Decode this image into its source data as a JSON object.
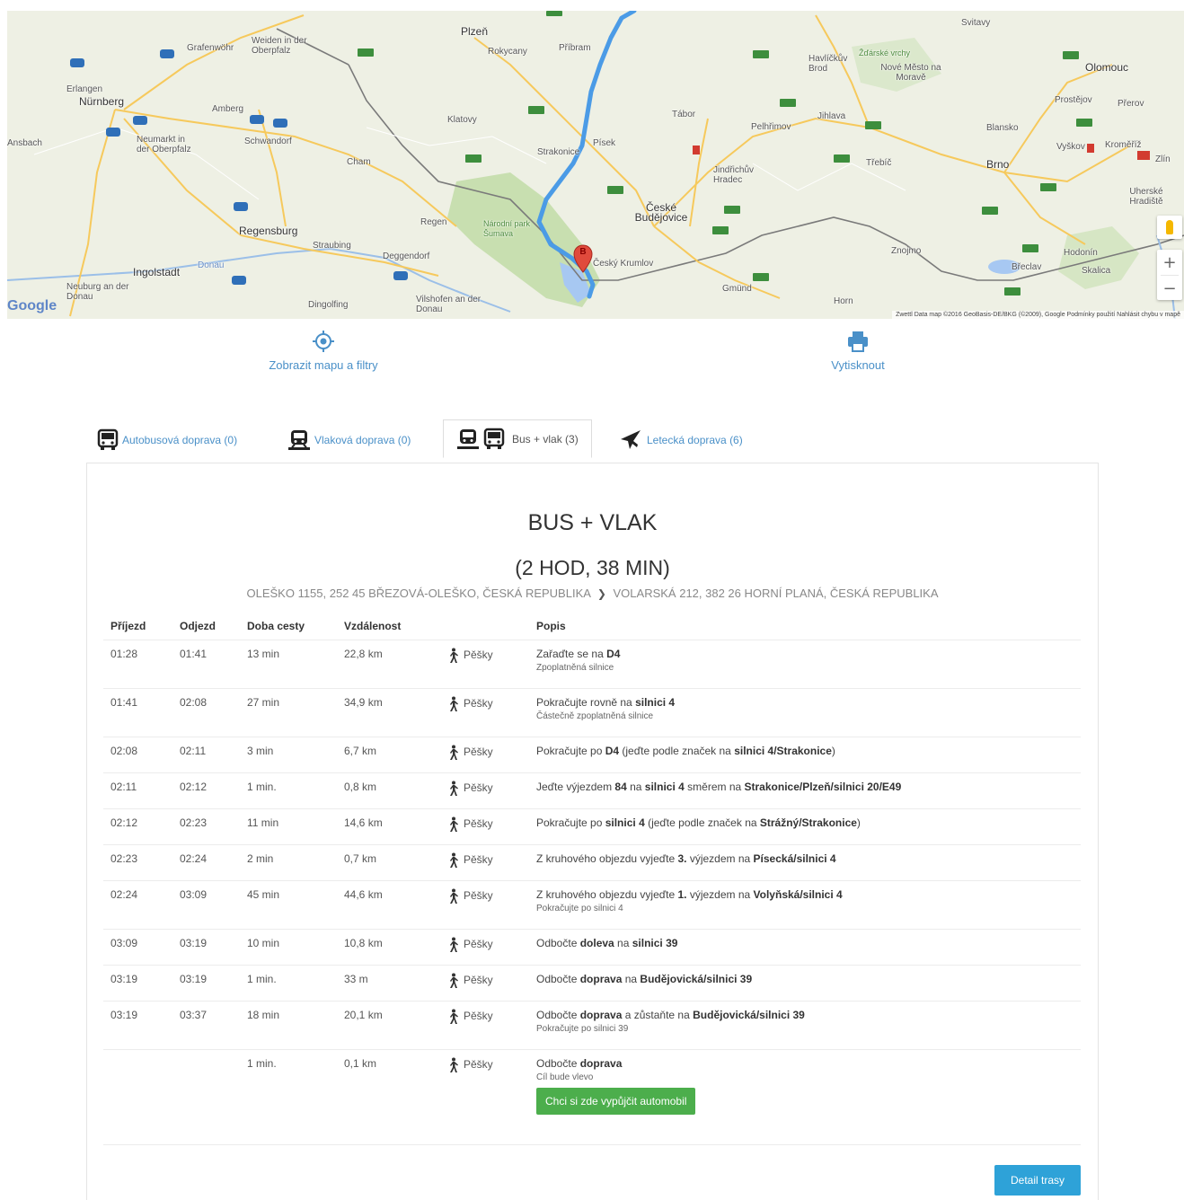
{
  "map": {
    "labels": {
      "nurnberg": "Nürnberg",
      "erlangen": "Erlangen",
      "ansbach": "Ansbach",
      "amberg": "Amberg",
      "schwandorf": "Schwandorf",
      "neumarkt": "Neumarkt in der Oberpfalz",
      "weiden": "Weiden in der Oberpfalz",
      "grafenwohr": "Grafenwöhr",
      "regensburg": "Regensburg",
      "ingolstadt": "Ingolstadt",
      "neuburg": "Neuburg an der Donau",
      "straubing": "Straubing",
      "deggendorf": "Deggendorf",
      "dingolfing": "Dingolfing",
      "vilshofen": "Vilshofen an der Donau",
      "cham": "Cham",
      "regen": "Regen",
      "plzen": "Plzeň",
      "rokycany": "Rokycany",
      "pribram": "Příbram",
      "klatovy": "Klatovy",
      "strakonice": "Strakonice",
      "pisek": "Písek",
      "tabor": "Tábor",
      "ceske_budejovice": "České Budějovice",
      "cesky_krumlov": "Český Krumlov",
      "sumava": "Národní park Šumava",
      "pelhrimov": "Pelhřimov",
      "jihlava": "Jihlava",
      "havlickuv_brod": "Havlíčkův Brod",
      "zdarske_vrchy": "Žďárské vrchy",
      "nove_mesto": "Nové Město na Moravě",
      "jindrichuv_hradec": "Jindřichův Hradec",
      "trebic": "Třebíč",
      "znojmo": "Znojmo",
      "brno": "Brno",
      "blansko": "Blansko",
      "olomouc": "Olomouc",
      "prostejov": "Prostějov",
      "prerov": "Přerov",
      "vyskov": "Vyškov",
      "kromeriz": "Kroměříž",
      "zlin": "Zlín",
      "uherske_hradiste": "Uherské Hradiště",
      "hodonin": "Hodonín",
      "skalica": "Skalica",
      "breclav": "Břeclav",
      "zwettl": "Zwettl",
      "gmund": "Gmünd",
      "horn": "Horn",
      "svitavy": "Svitavy",
      "donau": "Donau"
    },
    "google": "Google",
    "attribution": "Zwettl   Data map ©2016 GeoBasis-DE/BKG (©2009), Google   Podmínky použití   Nahlásit chybu v mapě",
    "marker_label": "B"
  },
  "actions": {
    "show_map": "Zobrazit mapu a filtry",
    "print": "Vytisknout"
  },
  "tabs": [
    {
      "label": "Autobusová doprava (0)"
    },
    {
      "label": "Vlaková doprava (0)"
    },
    {
      "label": "Bus + vlak (3)"
    },
    {
      "label": "Letecká doprava (6)"
    }
  ],
  "panel": {
    "title": "BUS + VLAK",
    "duration": "(2 HOD, 38 MIN)",
    "from": "OLEŠKO 1155, 252 45 BŘEZOVÁ-OLEŠKO, ČESKÁ REPUBLIKA",
    "to": "VOLARSKÁ 212, 382 26 HORNÍ PLANÁ, ČESKÁ REPUBLIKA",
    "headers": [
      "Příjezd",
      "Odjezd",
      "Doba cesty",
      "Vzdálenost",
      "",
      "Popis"
    ],
    "walk_label": "Pěšky",
    "rent_button": "Chci si zde vypůjčit automobil",
    "detail_button": "Detail trasy"
  },
  "steps": [
    {
      "arr": "01:28",
      "dep": "01:41",
      "dur": "13 min",
      "dist": "22,8 km",
      "desc_parts": [
        "Zařaďte se na ",
        "D4"
      ],
      "sub": "Zpoplatněná silnice"
    },
    {
      "arr": "01:41",
      "dep": "02:08",
      "dur": "27 min",
      "dist": "34,9 km",
      "desc_parts": [
        "Pokračujte rovně na ",
        "silnici 4"
      ],
      "sub": "Částečně zpoplatněná silnice"
    },
    {
      "arr": "02:08",
      "dep": "02:11",
      "dur": "3 min",
      "dist": "6,7 km",
      "desc_parts": [
        "Pokračujte po ",
        "D4",
        " (jeďte podle značek na ",
        "silnici 4/Strakonice",
        ")"
      ],
      "sub": ""
    },
    {
      "arr": "02:11",
      "dep": "02:12",
      "dur": "1 min.",
      "dist": "0,8 km",
      "desc_parts": [
        "Jeďte výjezdem ",
        "84",
        " na ",
        "silnici 4",
        " směrem na ",
        "Strakonice/Plzeň/silnici 20/E49"
      ],
      "sub": ""
    },
    {
      "arr": "02:12",
      "dep": "02:23",
      "dur": "11 min",
      "dist": "14,6 km",
      "desc_parts": [
        "Pokračujte po ",
        "silnici 4",
        " (jeďte podle značek na ",
        "Strážný/Strakonice",
        ")"
      ],
      "sub": ""
    },
    {
      "arr": "02:23",
      "dep": "02:24",
      "dur": "2 min",
      "dist": "0,7 km",
      "desc_parts": [
        "Z kruhového objezdu vyjeďte ",
        "3.",
        " výjezdem na ",
        "Písecká/silnici 4"
      ],
      "sub": ""
    },
    {
      "arr": "02:24",
      "dep": "03:09",
      "dur": "45 min",
      "dist": "44,6 km",
      "desc_parts": [
        "Z kruhového objezdu vyjeďte ",
        "1.",
        " výjezdem na ",
        "Volyňská/silnici 4"
      ],
      "sub": "Pokračujte po silnici 4"
    },
    {
      "arr": "03:09",
      "dep": "03:19",
      "dur": "10 min",
      "dist": "10,8 km",
      "desc_parts": [
        "Odbočte ",
        "doleva",
        " na ",
        "silnici 39"
      ],
      "sub": ""
    },
    {
      "arr": "03:19",
      "dep": "03:19",
      "dur": "1 min.",
      "dist": "33 m",
      "desc_parts": [
        "Odbočte ",
        "doprava",
        " na ",
        "Budějovická/silnici 39"
      ],
      "sub": ""
    },
    {
      "arr": "03:19",
      "dep": "03:37",
      "dur": "18 min",
      "dist": "20,1 km",
      "desc_parts": [
        "Odbočte ",
        "doprava",
        " a zůstaňte na ",
        "Budějovická/silnici 39"
      ],
      "sub": "Pokračujte po silnici 39"
    },
    {
      "arr": "",
      "dep": "",
      "dur": "1 min.",
      "dist": "0,1 km",
      "desc_parts": [
        "Odbočte ",
        "doprava"
      ],
      "sub": "Cíl bude vlevo"
    }
  ],
  "colors": {
    "link": "#4a90c8",
    "route_line": "#4b9be6",
    "green_button": "#4cae4c",
    "blue_button": "#2ea2d8",
    "marker": "#e04a3c"
  }
}
